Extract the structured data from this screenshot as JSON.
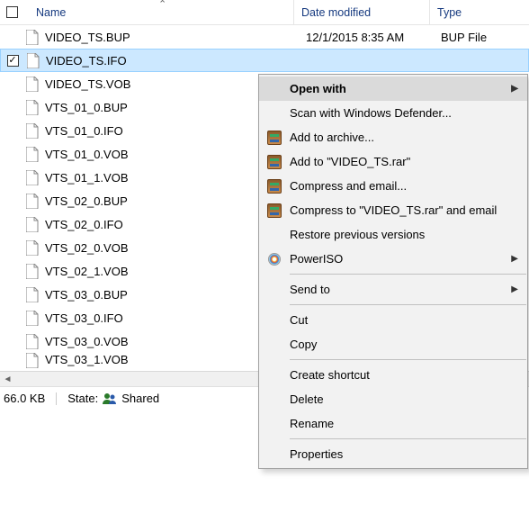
{
  "header": {
    "name": "Name",
    "date": "Date modified",
    "type": "Type"
  },
  "rows": [
    {
      "name": "VIDEO_TS.BUP",
      "date": "12/1/2015 8:35 AM",
      "type": "BUP File",
      "selected": false,
      "checked": false
    },
    {
      "name": "VIDEO_TS.IFO",
      "date": "",
      "type": "",
      "selected": true,
      "checked": true
    },
    {
      "name": "VIDEO_TS.VOB",
      "date": "",
      "type": "",
      "selected": false,
      "checked": false
    },
    {
      "name": "VTS_01_0.BUP",
      "date": "",
      "type": "",
      "selected": false,
      "checked": false
    },
    {
      "name": "VTS_01_0.IFO",
      "date": "",
      "type": "",
      "selected": false,
      "checked": false
    },
    {
      "name": "VTS_01_0.VOB",
      "date": "",
      "type": "",
      "selected": false,
      "checked": false
    },
    {
      "name": "VTS_01_1.VOB",
      "date": "",
      "type": "",
      "selected": false,
      "checked": false
    },
    {
      "name": "VTS_02_0.BUP",
      "date": "",
      "type": "",
      "selected": false,
      "checked": false
    },
    {
      "name": "VTS_02_0.IFO",
      "date": "",
      "type": "",
      "selected": false,
      "checked": false
    },
    {
      "name": "VTS_02_0.VOB",
      "date": "",
      "type": "",
      "selected": false,
      "checked": false
    },
    {
      "name": "VTS_02_1.VOB",
      "date": "",
      "type": "",
      "selected": false,
      "checked": false
    },
    {
      "name": "VTS_03_0.BUP",
      "date": "",
      "type": "",
      "selected": false,
      "checked": false
    },
    {
      "name": "VTS_03_0.IFO",
      "date": "",
      "type": "",
      "selected": false,
      "checked": false
    },
    {
      "name": "VTS_03_0.VOB",
      "date": "",
      "type": "",
      "selected": false,
      "checked": false
    }
  ],
  "partial_row": {
    "name": "VTS_03_1.VOB"
  },
  "status": {
    "size": "66.0 KB",
    "state_label": "State:",
    "state_value": "Shared"
  },
  "menu": {
    "open_with": "Open with",
    "defender": "Scan with Windows Defender...",
    "add_archive": "Add to archive...",
    "add_to_rar": "Add to \"VIDEO_TS.rar\"",
    "compress_email": "Compress and email...",
    "compress_to_email": "Compress to \"VIDEO_TS.rar\" and email",
    "restore": "Restore previous versions",
    "poweriso": "PowerISO",
    "send_to": "Send to",
    "cut": "Cut",
    "copy": "Copy",
    "create_shortcut": "Create shortcut",
    "delete": "Delete",
    "rename": "Rename",
    "properties": "Properties"
  }
}
